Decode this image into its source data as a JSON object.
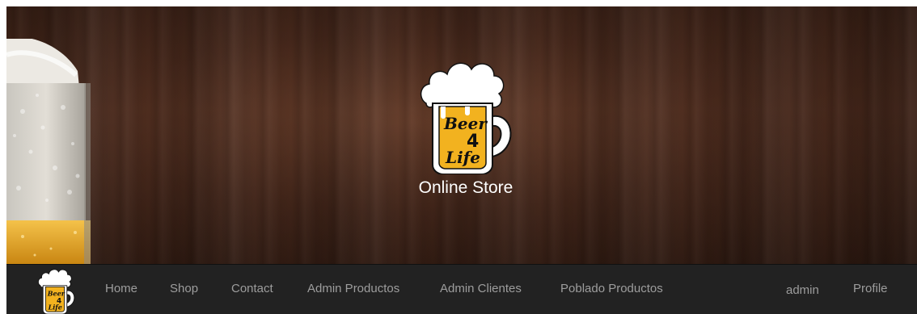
{
  "hero": {
    "logo_text": "Beer 4 Life",
    "subtitle": "Online Store"
  },
  "navbar": {
    "logo_text": "Beer 4 Life",
    "links": [
      "Home",
      "Shop",
      "Contact",
      "Admin Productos",
      "Admin Clientes",
      "Poblado Productos"
    ],
    "right": {
      "user": "admin",
      "profile": "Profile"
    }
  },
  "colors": {
    "navbar_bg": "#222222",
    "nav_text": "#9d9d9d",
    "logo_yellow": "#f2b21f",
    "wood_brown": "#4e2c1e"
  }
}
